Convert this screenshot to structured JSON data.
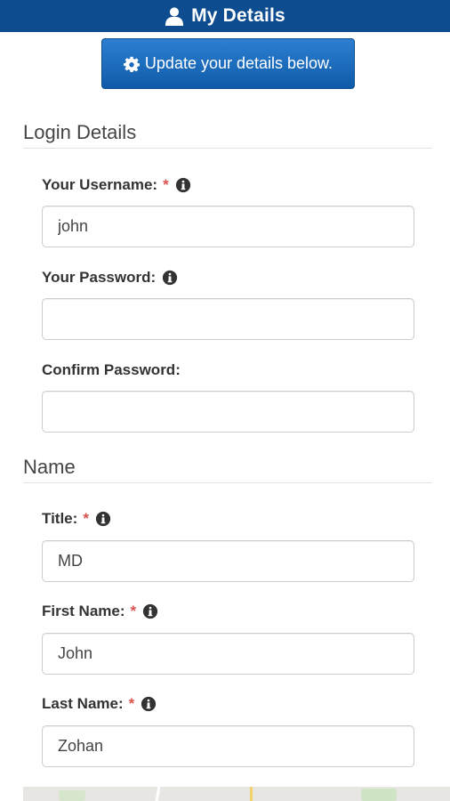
{
  "header": {
    "title": "My Details",
    "icon": "user-icon",
    "background": "#0d4c8f"
  },
  "update_button": {
    "label": "Update your details below.",
    "icon": "gear-icon",
    "color": "#1a6bbf"
  },
  "sections": {
    "login": {
      "title": "Login Details",
      "username": {
        "label": "Your Username:",
        "required": "*",
        "value": "john",
        "icon": "info-icon"
      },
      "password": {
        "label": "Your Password:",
        "value": "",
        "icon": "info-icon"
      },
      "confirm": {
        "label": "Confirm Password:",
        "value": ""
      }
    },
    "name": {
      "title": "Name",
      "title_field": {
        "label": "Title:",
        "required": "*",
        "value": "MD",
        "icon": "info-icon"
      },
      "first": {
        "label": "First Name:",
        "required": "*",
        "value": "John",
        "icon": "info-icon"
      },
      "last": {
        "label": "Last Name:",
        "required": "*",
        "value": "Zohan",
        "icon": "info-icon"
      }
    }
  },
  "colors": {
    "required_marker": "#d9534f"
  }
}
